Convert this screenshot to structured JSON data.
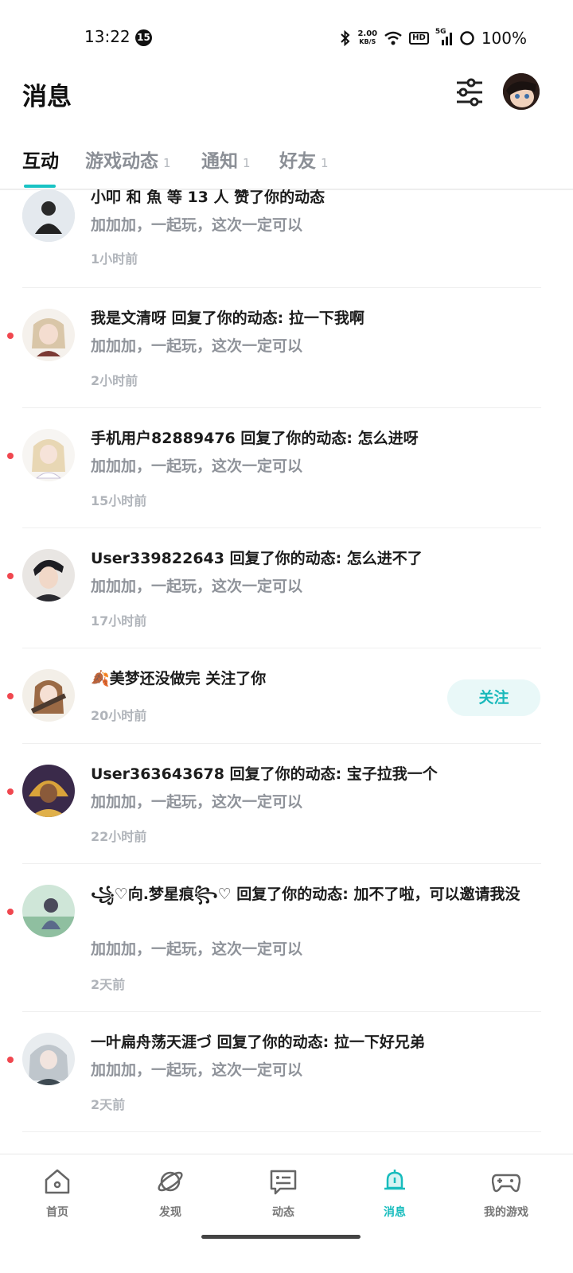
{
  "status_bar": {
    "time": "13:22",
    "notification_count": "15",
    "net_speed_value": "2.00",
    "net_speed_unit": "KB/S",
    "hd": "HD",
    "signal": "5G",
    "battery": "100%"
  },
  "header": {
    "title": "消息"
  },
  "tabs": [
    {
      "label": "互动",
      "count": ""
    },
    {
      "label": "游戏动态",
      "count": "1"
    },
    {
      "label": "通知",
      "count": "1"
    },
    {
      "label": "好友",
      "count": "1"
    }
  ],
  "messages": [
    {
      "title": "小叩 和 魚 等 13 人 赞了你的动态",
      "subtitle": "加加加，一起玩，这次一定可以",
      "time": "1小时前",
      "unread": false
    },
    {
      "title": "我是文清呀 回复了你的动态: 拉一下我啊",
      "subtitle": "加加加，一起玩，这次一定可以",
      "time": "2小时前",
      "unread": true
    },
    {
      "title": "手机用户82889476 回复了你的动态: 怎么进呀",
      "subtitle": "加加加，一起玩，这次一定可以",
      "time": "15小时前",
      "unread": true
    },
    {
      "title": "User339822643 回复了你的动态: 怎么进不了",
      "subtitle": "加加加，一起玩，这次一定可以",
      "time": "17小时前",
      "unread": true
    },
    {
      "title": "🍂美梦还没做完 关注了你",
      "subtitle": "",
      "time": "20小时前",
      "unread": true,
      "action": "关注"
    },
    {
      "title": "User363643678 回复了你的动态: 宝子拉我一个",
      "subtitle": "加加加，一起玩，这次一定可以",
      "time": "22小时前",
      "unread": true
    },
    {
      "title": "꧁♡向.梦星痕꧂♡ 回复了你的动态: 加不了啦，可以邀请我没",
      "subtitle": "加加加，一起玩，这次一定可以",
      "time": "2天前",
      "unread": true
    },
    {
      "title": "一叶扁舟荡天涯づ 回复了你的动态: 拉一下好兄弟",
      "subtitle": "加加加，一起玩，这次一定可以",
      "time": "2天前",
      "unread": true
    }
  ],
  "bottom_nav": [
    {
      "label": "首页",
      "icon": "home-icon"
    },
    {
      "label": "发现",
      "icon": "planet-icon"
    },
    {
      "label": "动态",
      "icon": "feed-icon"
    },
    {
      "label": "消息",
      "icon": "bell-icon",
      "active": true
    },
    {
      "label": "我的游戏",
      "icon": "gamepad-icon"
    }
  ],
  "colors": {
    "accent": "#19c3c4",
    "unread_dot": "#f0474f"
  }
}
